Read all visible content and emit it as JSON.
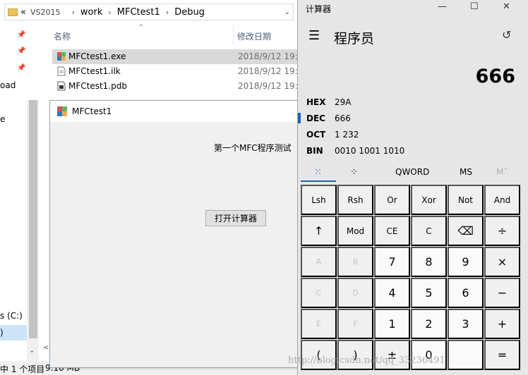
{
  "explorer": {
    "breadcrumb": [
      "VS2015",
      "work",
      "MFCtest1",
      "Debug"
    ],
    "nav_text": [
      "oad",
      "e",
      "s (C:)",
      ")"
    ],
    "columns": {
      "name": "名称",
      "date": "修改日期"
    },
    "files": [
      {
        "name": "MFCtest1.exe",
        "date": "2018/9/12 19:5",
        "selected": true
      },
      {
        "name": "MFCtest1.ilk",
        "date": "2018/9/12 19:5",
        "selected": false
      },
      {
        "name": "MFCtest1.pdb",
        "date": "2018/9/12 19:5",
        "selected": false
      }
    ],
    "status": {
      "count": "中 1 个项目",
      "size": "9.10 MB"
    }
  },
  "mfc": {
    "title": "MFCtest1",
    "label": "第一个MFC程序测试",
    "button": "打开计算器"
  },
  "calc": {
    "title": "计算器",
    "mode": "程序员",
    "display": "666",
    "radix": [
      {
        "key": "HEX",
        "value": "29A",
        "active": false
      },
      {
        "key": "DEC",
        "value": "666",
        "active": true
      },
      {
        "key": "OCT",
        "value": "1 232",
        "active": false
      },
      {
        "key": "BIN",
        "value": "0010 1001 1010",
        "active": false
      }
    ],
    "tabs": {
      "word": "QWORD",
      "ms": "MS",
      "mv": "M˅"
    },
    "keys": [
      [
        "Lsh",
        "Rsh",
        "Or",
        "Xor",
        "Not",
        "And"
      ],
      [
        "↑",
        "Mod",
        "CE",
        "C",
        "⌫",
        "÷"
      ],
      [
        "A",
        "B",
        "7",
        "8",
        "9",
        "×"
      ],
      [
        "C",
        "D",
        "4",
        "5",
        "6",
        "−"
      ],
      [
        "E",
        "F",
        "1",
        "2",
        "3",
        "+"
      ],
      [
        "(",
        ")",
        "±",
        "0",
        "",
        "="
      ]
    ]
  },
  "watermark": "http://blog.csdn.net/qq_33236491"
}
